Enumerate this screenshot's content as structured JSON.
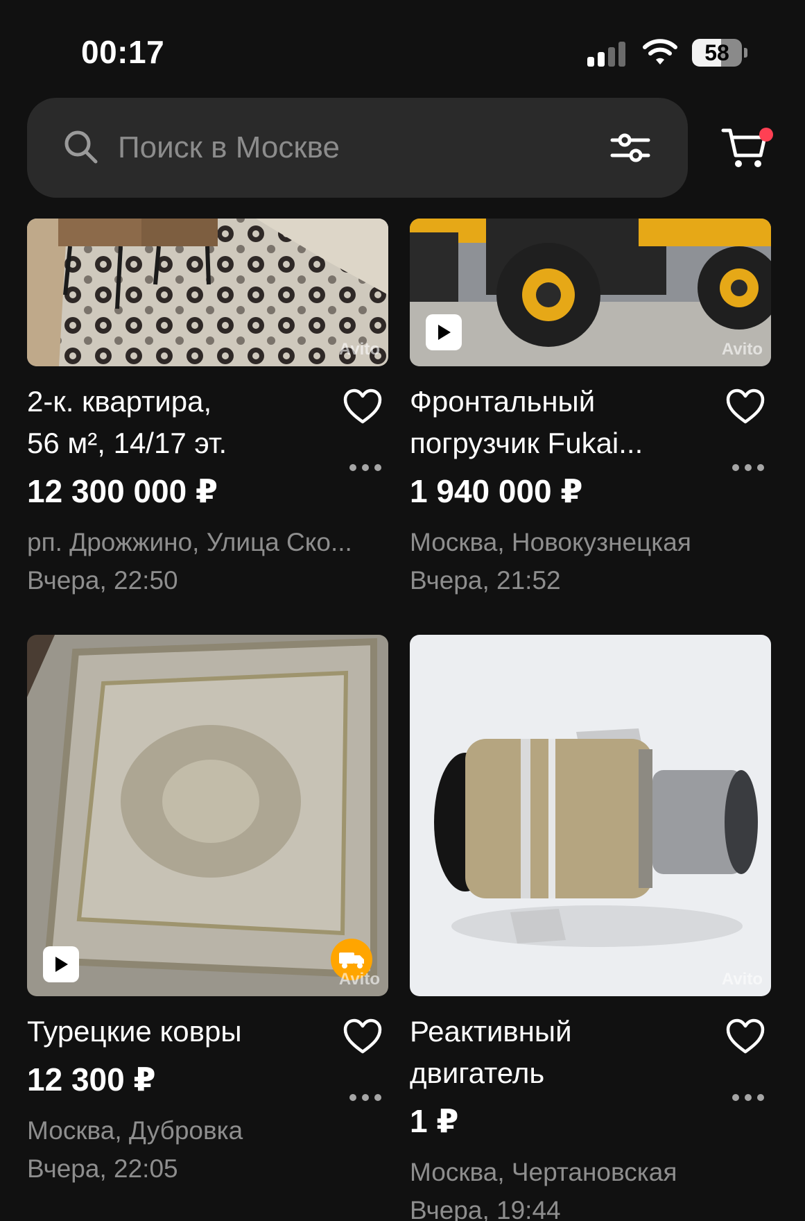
{
  "status": {
    "time": "00:17",
    "battery": "58",
    "battery_level": 0.58
  },
  "search": {
    "placeholder": "Поиск в Москве"
  },
  "colors": {
    "background": "#111111",
    "search_bg": "#2a2a2a",
    "muted_text": "#8e8e8e",
    "cart_badge": "#ff4053",
    "delivery_badge": "#ffa500"
  },
  "icons": [
    "search-icon",
    "filter-icon",
    "cart-icon",
    "heart-icon",
    "more-icon",
    "play-icon",
    "truck-icon"
  ],
  "listings": [
    {
      "title_line1": "2-к. квартира,",
      "title_line2": "56 м², 14/17 эт.",
      "price": "12 300 000 ₽",
      "location": "рп. Дрожжино, Улица Ско...",
      "date": "Вчера, 22:50",
      "watermark": "Avito"
    },
    {
      "title_line1": "Фронтальный",
      "title_line2": "погрузчик Fukai...",
      "price": "1 940 000 ₽",
      "location": "Москва, Новокузнецкая",
      "date": "Вчера, 21:52",
      "watermark": "Avito"
    },
    {
      "title_line1": "Турецкие ковры",
      "price": "12 300 ₽",
      "location": "Москва, Дубровка",
      "date": "Вчера, 22:05",
      "watermark": "Avito"
    },
    {
      "title_line1": "Реактивный",
      "title_line2": "двигатель",
      "price": "1 ₽",
      "location": "Москва, Чертановская",
      "date": "Вчера, 19:44",
      "watermark": "Avito"
    }
  ]
}
